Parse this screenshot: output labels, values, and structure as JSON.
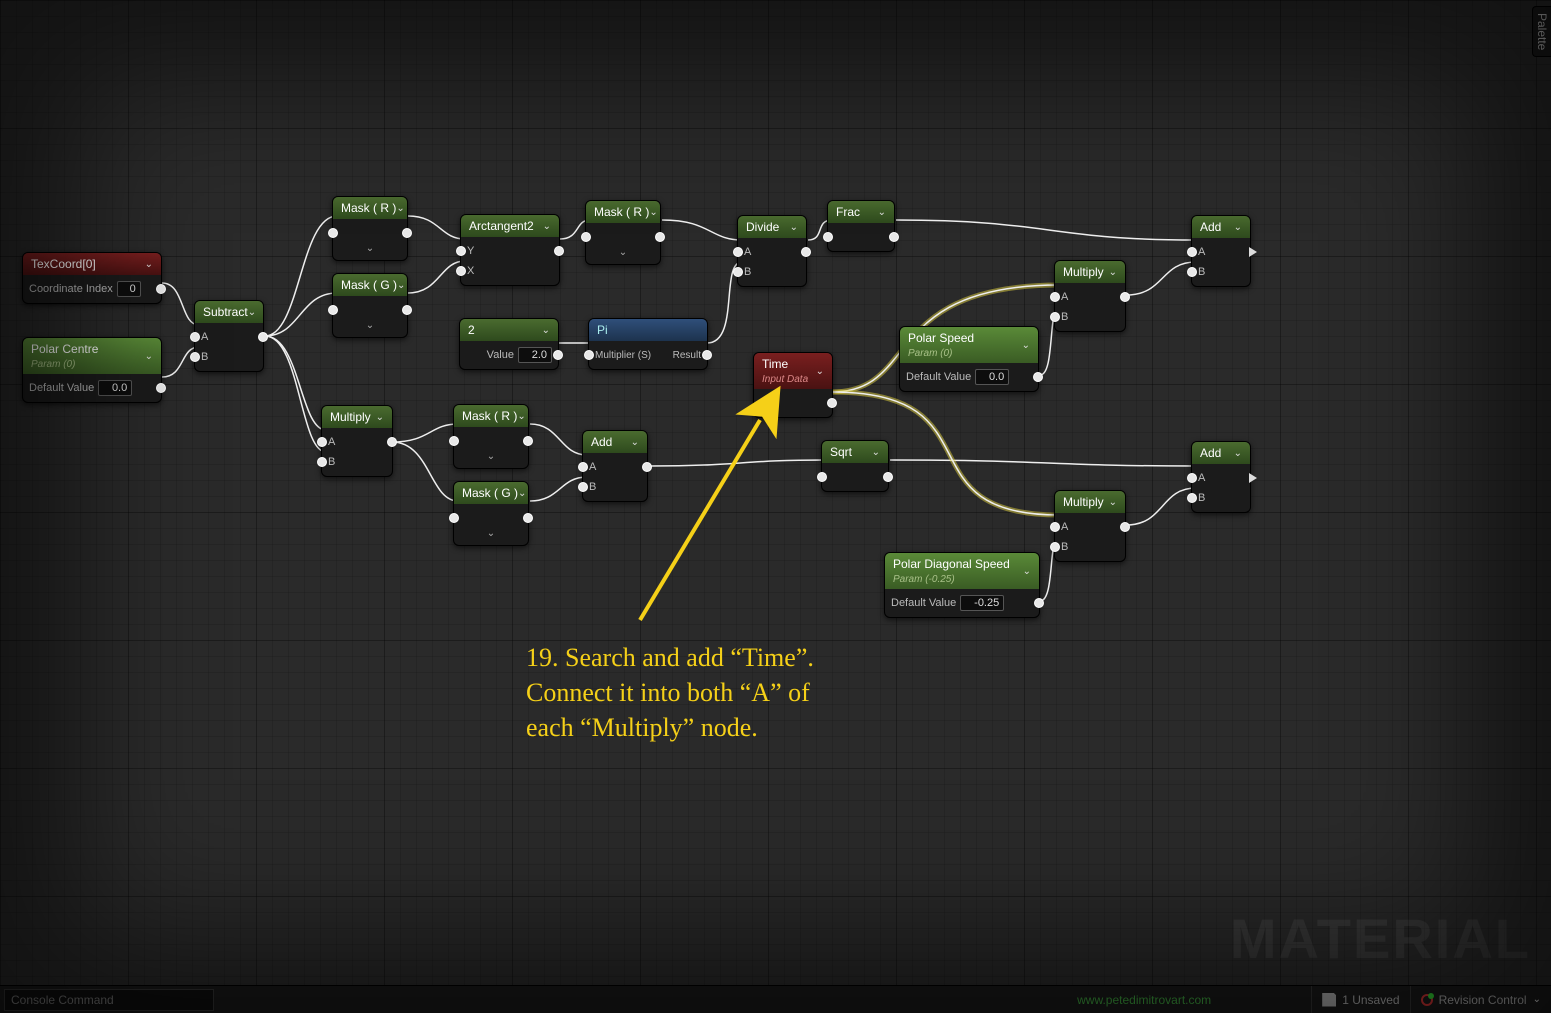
{
  "palette_tab": "Palette",
  "watermark": "MATERIAL",
  "footer": {
    "console_placeholder": "Console Command",
    "link": "www.petedimitrovart.com",
    "unsaved": "1 Unsaved",
    "revision": "Revision Control"
  },
  "annotation": {
    "line1": "19. Search and add “Time”.",
    "line2": "Connect it into both “A” of",
    "line3": "each “Multiply” node."
  },
  "nodes": {
    "texcoord": {
      "title": "TexCoord[0]",
      "param_label": "Coordinate Index",
      "param_value": "0"
    },
    "polar_centre": {
      "title": "Polar Centre",
      "subtitle": "Param (0)",
      "param_label": "Default Value",
      "param_value": "0.0"
    },
    "subtract": {
      "title": "Subtract",
      "pinA": "A",
      "pinB": "B"
    },
    "mask_r1": {
      "title": "Mask ( R )"
    },
    "mask_g1": {
      "title": "Mask ( G )"
    },
    "arctan2": {
      "title": "Arctangent2",
      "pinY": "Y",
      "pinX": "X"
    },
    "mask_r2": {
      "title": "Mask ( R )"
    },
    "const2": {
      "title": "2",
      "label": "Value",
      "value": "2.0"
    },
    "pi": {
      "title": "Pi",
      "inLabel": "Multiplier (S)",
      "outLabel": "Result"
    },
    "divide": {
      "title": "Divide",
      "pinA": "A",
      "pinB": "B"
    },
    "frac": {
      "title": "Frac"
    },
    "add_top": {
      "title": "Add",
      "pinA": "A",
      "pinB": "B"
    },
    "multiply_top": {
      "title": "Multiply",
      "pinA": "A",
      "pinB": "B"
    },
    "polar_speed": {
      "title": "Polar Speed",
      "subtitle": "Param (0)",
      "param_label": "Default Value",
      "param_value": "0.0"
    },
    "time": {
      "title": "Time",
      "subtitle": "Input Data"
    },
    "multiply_lower_left": {
      "title": "Multiply",
      "pinA": "A",
      "pinB": "B"
    },
    "mask_r3": {
      "title": "Mask ( R )"
    },
    "mask_g2": {
      "title": "Mask ( G )"
    },
    "add_mid": {
      "title": "Add",
      "pinA": "A",
      "pinB": "B"
    },
    "sqrt": {
      "title": "Sqrt"
    },
    "add_bottom": {
      "title": "Add",
      "pinA": "A",
      "pinB": "B"
    },
    "multiply_bottom": {
      "title": "Multiply",
      "pinA": "A",
      "pinB": "B"
    },
    "polar_diag_speed": {
      "title": "Polar Diagonal Speed",
      "subtitle": "Param (-0.25)",
      "param_label": "Default Value",
      "param_value": "-0.25"
    }
  }
}
